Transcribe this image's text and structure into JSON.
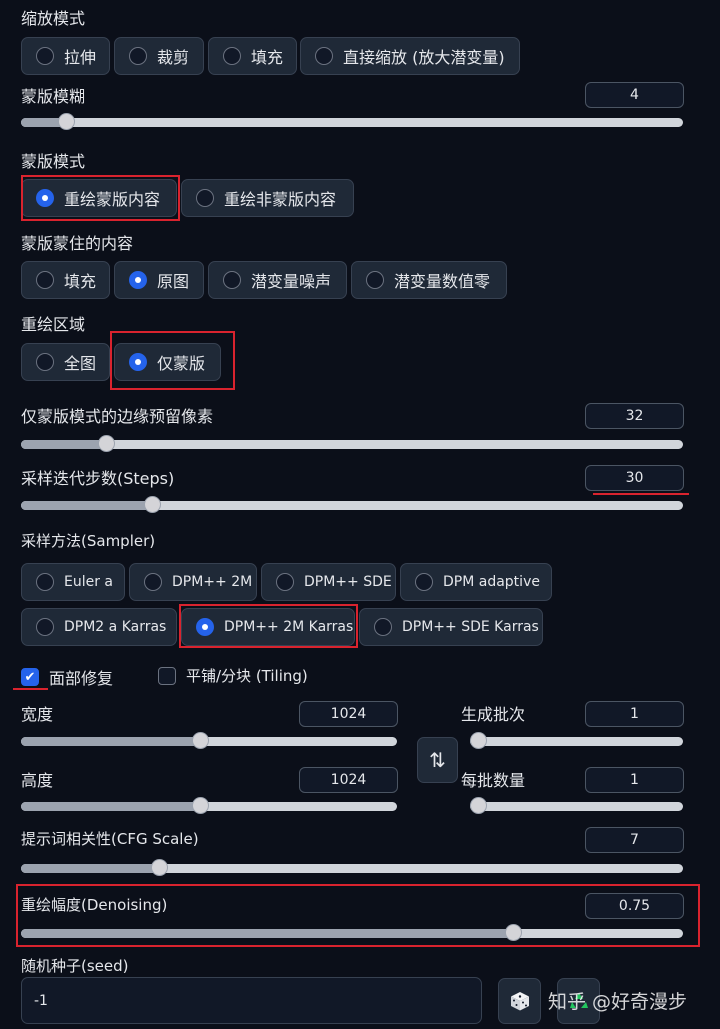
{
  "resize_mode": {
    "label": "缩放模式",
    "options": [
      "拉伸",
      "裁剪",
      "填充",
      "直接缩放 (放大潜变量)"
    ],
    "selected": null
  },
  "mask_blur": {
    "label": "蒙版模糊",
    "value": "4",
    "fraction": 0.07
  },
  "mask_mode": {
    "label": "蒙版模式",
    "options": [
      "重绘蒙版内容",
      "重绘非蒙版内容"
    ],
    "selected": 0
  },
  "masked_content": {
    "label": "蒙版蒙住的内容",
    "options": [
      "填充",
      "原图",
      "潜变量噪声",
      "潜变量数值零"
    ],
    "selected": 1
  },
  "inpaint_area": {
    "label": "重绘区域",
    "options": [
      "全图",
      "仅蒙版"
    ],
    "selected": 1
  },
  "padding": {
    "label": "仅蒙版模式的边缘预留像素",
    "value": "32",
    "fraction": 0.13
  },
  "steps": {
    "label": "采样迭代步数(Steps)",
    "value": "30",
    "fraction": 0.2
  },
  "sampler": {
    "label": "采样方法(Sampler)",
    "options": [
      "Euler a",
      "DPM++ 2M",
      "DPM++ SDE",
      "DPM adaptive",
      "DPM2 a Karras",
      "DPM++ 2M Karras",
      "DPM++ SDE Karras"
    ],
    "selected": 5
  },
  "checkboxes": {
    "face_restore": {
      "label": "面部修复",
      "checked": true,
      "mark": "✔"
    },
    "tiling": {
      "label": "平铺/分块 (Tiling)",
      "checked": false
    }
  },
  "width": {
    "label": "宽度",
    "value": "1024",
    "fraction": 0.48
  },
  "height": {
    "label": "高度",
    "value": "1024",
    "fraction": 0.48
  },
  "batch_count": {
    "label": "生成批次",
    "value": "1",
    "fraction": 0.0
  },
  "batch_size": {
    "label": "每批数量",
    "value": "1",
    "fraction": 0.0
  },
  "swap_icon": "⇅",
  "cfg": {
    "label": "提示词相关性(CFG Scale)",
    "value": "7",
    "fraction": 0.21
  },
  "denoising": {
    "label": "重绘幅度(Denoising)",
    "value": "0.75",
    "fraction": 0.745
  },
  "seed": {
    "label": "随机种子(seed)",
    "value": "-1"
  },
  "watermark": "知乎 @好奇漫步",
  "icons": {
    "dice": "dice-icon",
    "swap": "swap-icon",
    "recycle": "recycle-icon"
  },
  "colors": {
    "accent": "#2563eb",
    "highlight": "#d9232e",
    "background": "#0b0f19"
  }
}
